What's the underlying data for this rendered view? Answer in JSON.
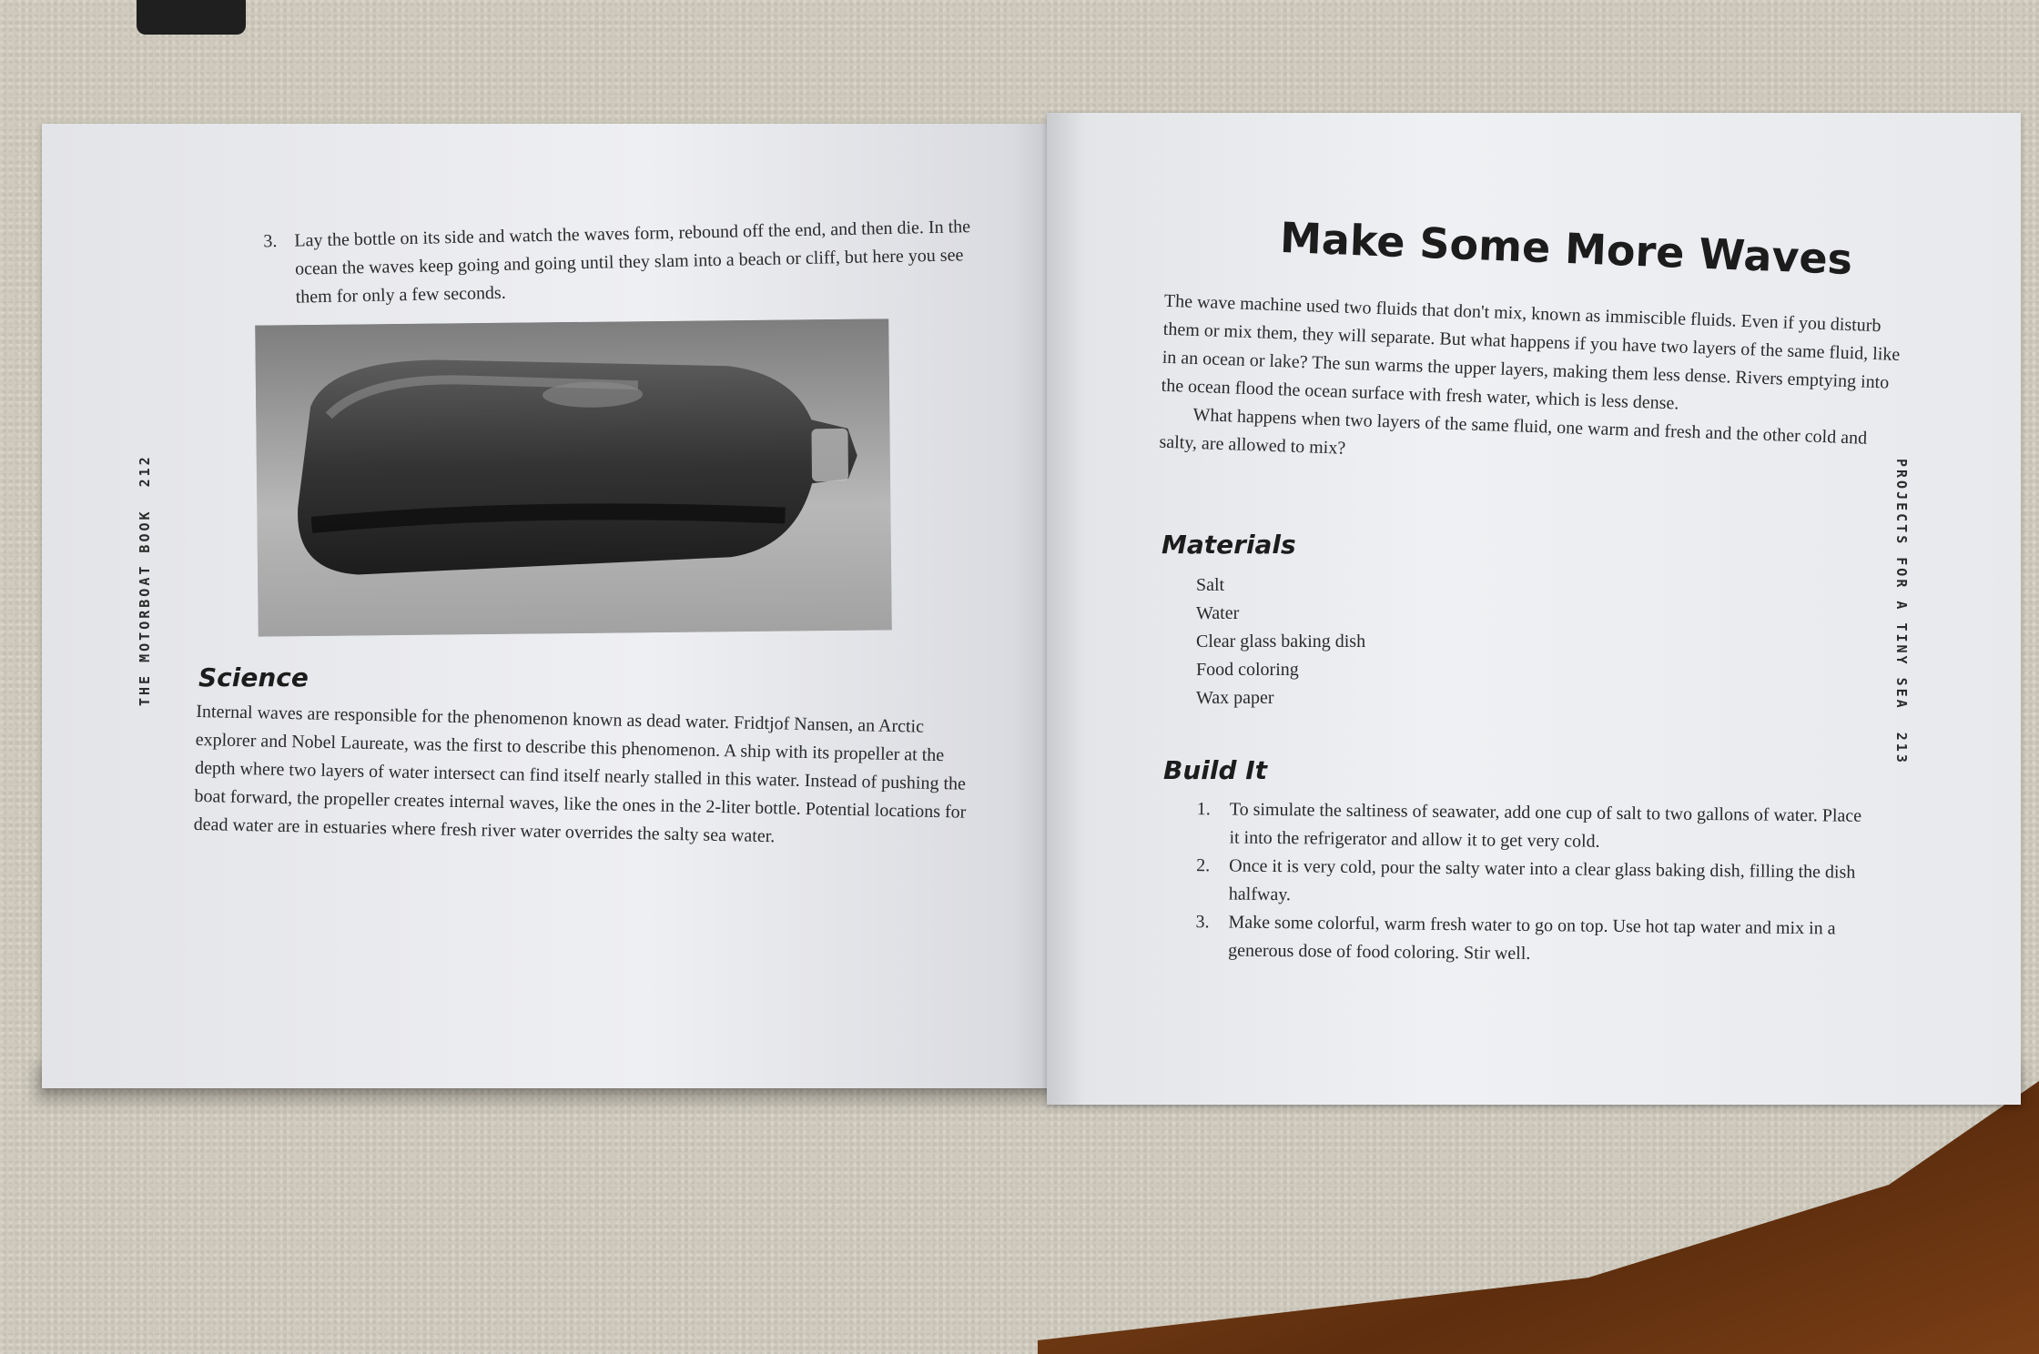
{
  "left_page": {
    "running_head": "THE MOTORBOAT BOOK",
    "page_number": "212",
    "step3_number": "3.",
    "step3_text": "Lay the bottle on its side and watch the waves form, rebound off the end, and then die. In the ocean the waves keep going and going until they slam into a beach or cliff, but here you see them for only a few seconds.",
    "science_heading": "Science",
    "science_text": "Internal waves are responsible for the phenomenon known as dead water. Fridtjof Nansen, an Arctic explorer and Nobel Laureate, was the first to describe this phenomenon. A ship with its propeller at the depth where two layers of water intersect can find itself nearly stalled in this water. Instead of pushing the boat forward, the propeller creates internal waves, like the ones in the 2-liter bottle. Potential locations for dead water are in estuaries where fresh river water overrides the salty sea water."
  },
  "right_page": {
    "title": "Make Some More Waves",
    "intro_p1": "The wave machine used two fluids that don't mix, known as immiscible fluids. Even if you disturb them or mix them, they will separate. But what happens if you have two layers of the same fluid, like in an ocean or lake? The sun warms the upper layers, making them less dense. Rivers emptying into the ocean flood the ocean surface with fresh water, which is less dense.",
    "intro_p2": "What happens when two layers of the same fluid, one warm and fresh and the other cold and salty, are allowed to mix?",
    "materials_heading": "Materials",
    "materials": [
      "Salt",
      "Water",
      "Clear glass baking dish",
      "Food coloring",
      "Wax paper"
    ],
    "build_heading": "Build It",
    "build_steps": [
      {
        "num": "1.",
        "text": "To simulate the saltiness of seawater, add one cup of salt to two gallons of water. Place it into the refrigerator and allow it to get very cold."
      },
      {
        "num": "2.",
        "text": "Once it is very cold, pour the salty water into a clear glass baking dish, filling the dish halfway."
      },
      {
        "num": "3.",
        "text": "Make some colorful, warm fresh water to go on top. Use hot tap water and mix in a generous dose of food coloring. Stir well."
      }
    ],
    "running_head": "PROJECTS FOR A TINY SEA",
    "page_number": "213"
  }
}
